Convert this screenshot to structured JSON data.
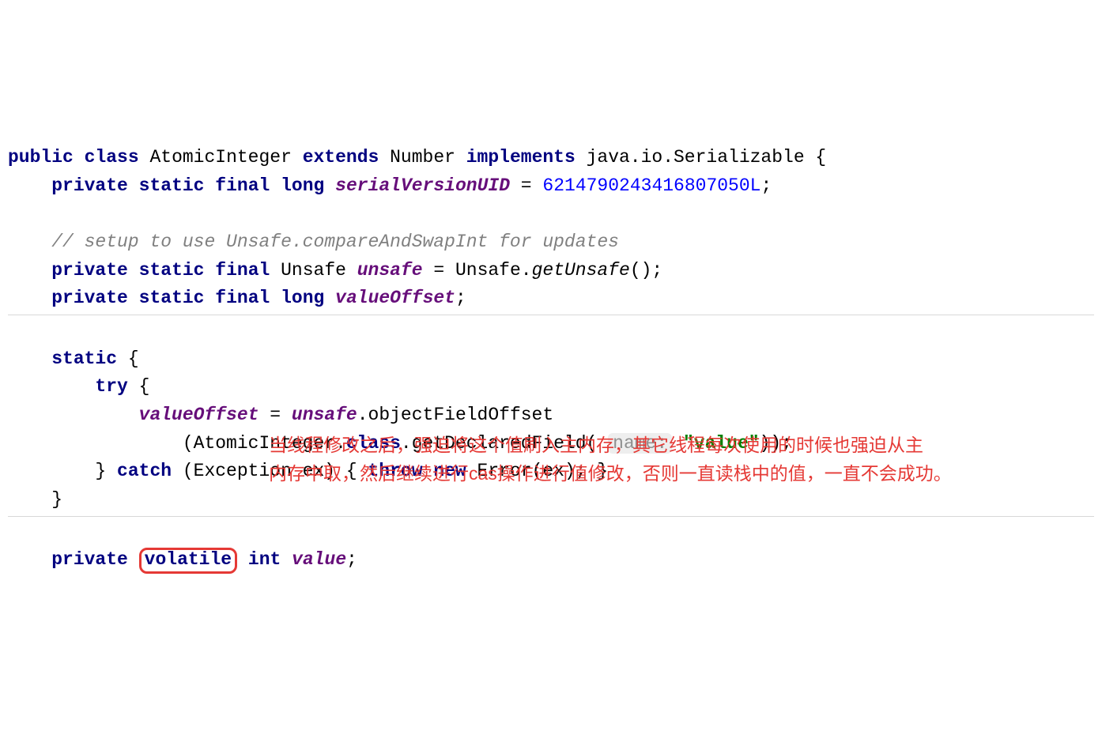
{
  "l1": {
    "kw_public": "public",
    "kw_class": "class",
    "classname": " AtomicInteger ",
    "kw_extends": "extends",
    "sup": " Number ",
    "kw_implements": "implements",
    "iface": " java.io.Serializable {"
  },
  "l2": {
    "indent": "    ",
    "kw_private": "private",
    "kw_static": "static",
    "kw_final": "final",
    "kw_long": "long",
    "field": "serialVersionUID",
    "eq": " = ",
    "num": "6214790243416807050L",
    "semi": ";"
  },
  "l3": {
    "indent": "    ",
    "text": "// setup to use Unsafe.compareAndSwapInt for updates"
  },
  "l4": {
    "indent": "    ",
    "kw_private": "private",
    "kw_static": "static",
    "kw_final": "final",
    "type": " Unsafe ",
    "field": "unsafe",
    "eq": " = Unsafe.",
    "call": "getUnsafe",
    "tail": "();"
  },
  "l5": {
    "indent": "    ",
    "kw_private": "private",
    "kw_static": "static",
    "kw_final": "final",
    "kw_long": "long",
    "field": "valueOffset",
    "semi": ";"
  },
  "l6": {
    "indent": "    ",
    "kw_static": "static",
    "brace": " {"
  },
  "l7": {
    "indent": "        ",
    "kw_try": "try",
    "brace": " {"
  },
  "l8": {
    "indent": "            ",
    "field1": "valueOffset",
    "eq": " = ",
    "field2": "unsafe",
    "tail": ".objectFieldOffset"
  },
  "l9": {
    "indent": "                (AtomicInteger.",
    "kw_class": "class",
    "mid": ".getDeclaredField( ",
    "hint": "name:",
    "sp": " ",
    "str": "\"value\"",
    "tail": "));"
  },
  "l10": {
    "indent": "        } ",
    "kw_catch": "catch",
    "args": " (Exception ex) { ",
    "kw_throw": "throw",
    "sp": " ",
    "kw_new": "new",
    "tail": " Error(ex); }"
  },
  "l11": {
    "indent": "    }"
  },
  "l12": {
    "indent": "    ",
    "kw_private": "private",
    "sp": " ",
    "kw_volatile": "volatile",
    "sp2": " ",
    "kw_int": "int",
    "sp3": " ",
    "field": "value",
    "semi": ";"
  },
  "annotation": {
    "line1": "当线程修改之后，强迫将这个值刷入主内存，其它线程每次使用的时候也强迫从主",
    "line2": "内存中取，然后继续进行cas操作进行值修改，否则一直读栈中的值，一直不会成功。"
  }
}
